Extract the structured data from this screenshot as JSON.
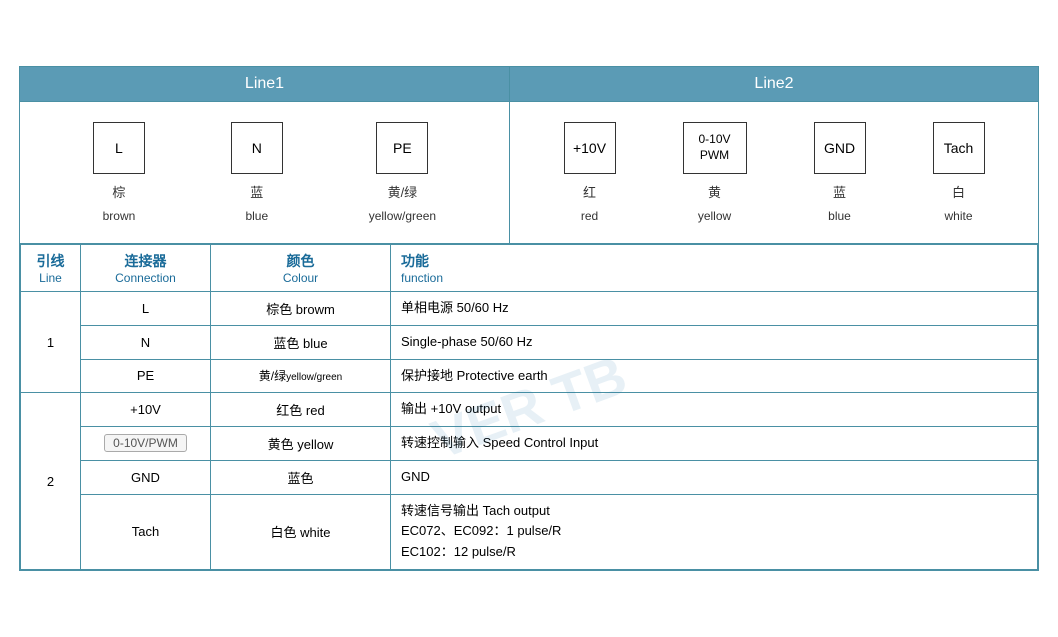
{
  "header": {
    "line1_label": "Line1",
    "line2_label": "Line2"
  },
  "line1_connectors": [
    {
      "id": "L",
      "label_zh": "棕",
      "label_en": "brown"
    },
    {
      "id": "N",
      "label_zh": "蓝",
      "label_en": "blue"
    },
    {
      "id": "PE",
      "label_zh": "黄/绿",
      "label_en": "yellow/green"
    }
  ],
  "line2_connectors": [
    {
      "id": "+10V",
      "label_zh": "红",
      "label_en": "red"
    },
    {
      "id": "0-10V\nPWM",
      "label_zh": "黄",
      "label_en": "yellow"
    },
    {
      "id": "GND",
      "label_zh": "蓝",
      "label_en": "blue"
    },
    {
      "id": "Tach",
      "label_zh": "白",
      "label_en": "white"
    }
  ],
  "table": {
    "headers": {
      "line_zh": "引线",
      "line_en": "Line",
      "conn_zh": "连接器",
      "conn_en": "Connection",
      "color_zh": "颜色",
      "color_en": "Colour",
      "func_zh": "功能",
      "func_en": "function"
    },
    "rows": [
      {
        "line": "1",
        "rowspan": 3,
        "entries": [
          {
            "conn": "L",
            "color_zh": "棕色",
            "color_en": "browm",
            "func": "单相电源 50/60 Hz"
          },
          {
            "conn": "N",
            "color_zh": "蓝色",
            "color_en": "blue",
            "func": "Single-phase 50/60 Hz"
          },
          {
            "conn": "PE",
            "color_zh": "黄/绿",
            "color_en_small": "yellow/green",
            "func": "保护接地 Protective earth"
          }
        ]
      },
      {
        "line": "2",
        "rowspan": 4,
        "entries": [
          {
            "conn": "+10V",
            "color_zh": "红色",
            "color_en": "red",
            "func": "输出 +10V output"
          },
          {
            "conn": "0-10V/PWM",
            "color_zh": "黄色",
            "color_en": "yellow",
            "func": "转速控制输入 Speed Control Input",
            "badge": true
          },
          {
            "conn": "GND",
            "color_zh": "蓝色",
            "color_en": "",
            "func": "GND"
          },
          {
            "conn": "Tach",
            "color_zh": "白色",
            "color_en": "white",
            "func_lines": [
              "转速信号输出 Tach output",
              "EC072、EC092：1 pulse/R",
              "EC102：12 pulse/R"
            ]
          }
        ]
      }
    ]
  },
  "watermark": "VER TB"
}
